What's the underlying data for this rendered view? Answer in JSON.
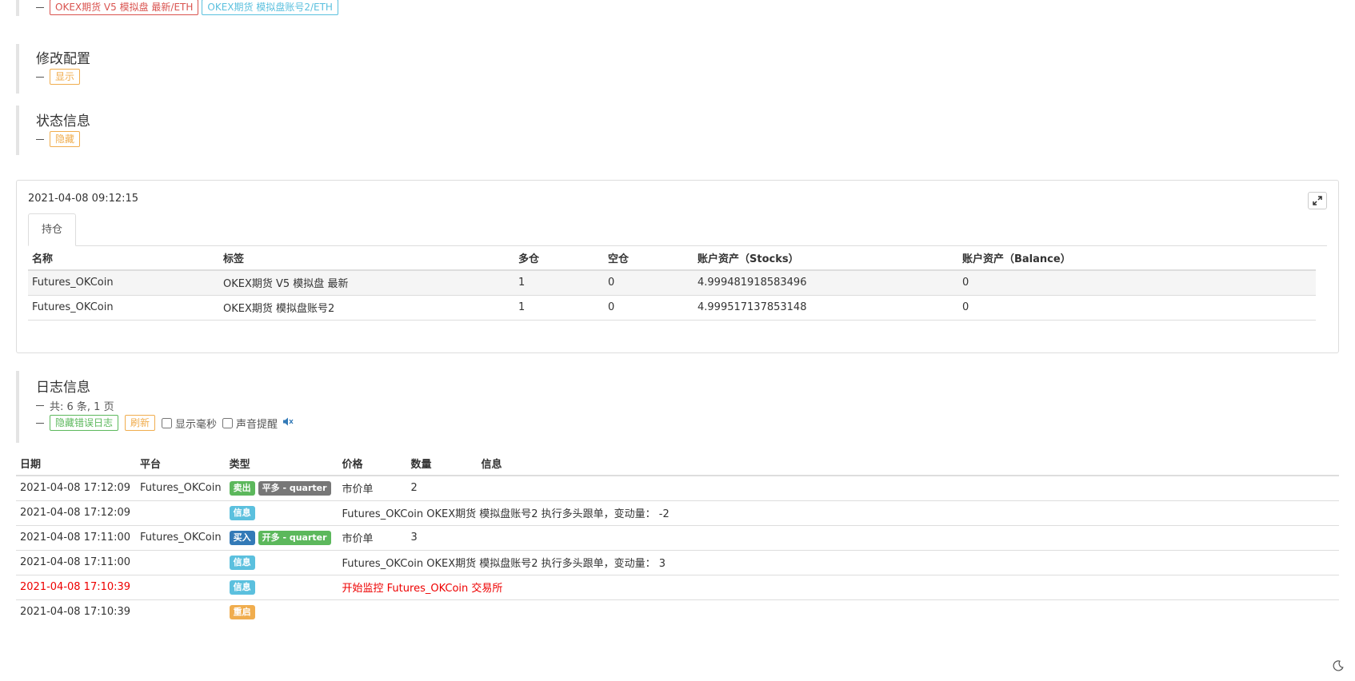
{
  "exchanges": {
    "items": [
      {
        "label": "OKEX期货 V5 模拟盘 最新/ETH",
        "color": "#d9534f"
      },
      {
        "label": "OKEX期货 模拟盘账号2/ETH",
        "color": "#5bc0de"
      }
    ]
  },
  "config": {
    "title": "修改配置",
    "toggle_label": "显示"
  },
  "status": {
    "title": "状态信息",
    "toggle_label": "隐藏"
  },
  "status_panel": {
    "timestamp": "2021-04-08 09:12:15",
    "tab_label": "持仓",
    "headers": [
      "名称",
      "标签",
      "多仓",
      "空仓",
      "账户资产（Stocks）",
      "账户资产（Balance）"
    ],
    "rows": [
      [
        "Futures_OKCoin",
        "OKEX期货 V5 模拟盘 最新",
        "1",
        "0",
        "4.999481918583496",
        "0"
      ],
      [
        "Futures_OKCoin",
        "OKEX期货 模拟盘账号2",
        "1",
        "0",
        "4.999517137853148",
        "0"
      ]
    ]
  },
  "logs": {
    "title": "日志信息",
    "summary": "共: 6 条, 1 页",
    "hide_errors_label": "隐藏错误日志",
    "refresh_label": "刷新",
    "show_ms_label": "显示毫秒",
    "sound_label": "声音提醒",
    "headers": [
      "日期",
      "平台",
      "类型",
      "价格",
      "数量",
      "信息"
    ],
    "rows": [
      {
        "date": "2021-04-08 17:12:09",
        "platform": "Futures_OKCoin",
        "type": "卖出",
        "type_color": "#5cb85c",
        "extra": "平多 - quarter",
        "extra_color": "#777777",
        "price": "市价单",
        "amount": "2",
        "info": ""
      },
      {
        "date": "2021-04-08 17:12:09",
        "platform": "",
        "type": "信息",
        "type_color": "#5bc0de",
        "extra": "",
        "price": "",
        "amount": "",
        "info": "Futures_OKCoin OKEX期货 模拟盘账号2 执行多头跟单，变动量： -2"
      },
      {
        "date": "2021-04-08 17:11:00",
        "platform": "Futures_OKCoin",
        "type": "买入",
        "type_color": "#337ab7",
        "extra": "开多 - quarter",
        "extra_color": "#5cb85c",
        "price": "市价单",
        "amount": "3",
        "info": ""
      },
      {
        "date": "2021-04-08 17:11:00",
        "platform": "",
        "type": "信息",
        "type_color": "#5bc0de",
        "extra": "",
        "price": "",
        "amount": "",
        "info": "Futures_OKCoin OKEX期货 模拟盘账号2 执行多头跟单，变动量： 3"
      },
      {
        "date": "2021-04-08 17:10:39",
        "platform": "",
        "type": "信息",
        "type_color": "#5bc0de",
        "extra": "",
        "price": "",
        "amount": "",
        "info": "开始监控 Futures_OKCoin 交易所",
        "error": true
      },
      {
        "date": "2021-04-08 17:10:39",
        "platform": "",
        "type": "重启",
        "type_color": "#f0ad4e",
        "extra": "",
        "price": "",
        "amount": "",
        "info": ""
      }
    ]
  }
}
